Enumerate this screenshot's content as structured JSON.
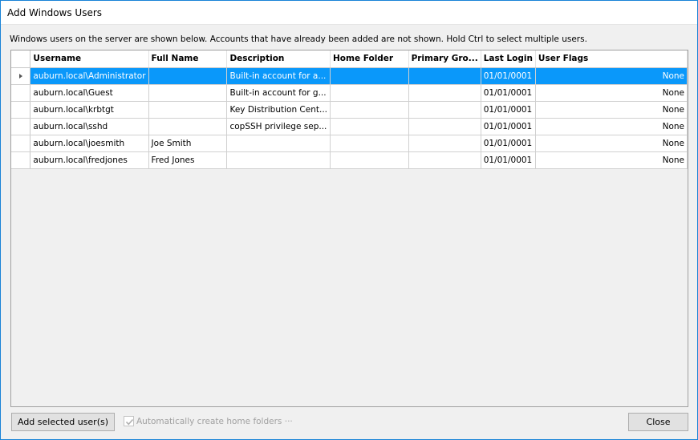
{
  "window": {
    "title": "Add Windows Users"
  },
  "instructions": "Windows users on the server are shown below.  Accounts that have already been added are not shown.  Hold Ctrl to select multiple users.",
  "grid": {
    "columns": [
      "Username",
      "Full Name",
      "Description",
      "Home Folder",
      "Primary Gro...",
      "Last Login",
      "User Flags"
    ],
    "rows": [
      {
        "username": "auburn.local\\Administrator",
        "full_name": "",
        "description": "Built-in account for a...",
        "home_folder": "",
        "primary_group": "",
        "last_login": "01/01/0001",
        "user_flags": "None",
        "selected": true
      },
      {
        "username": "auburn.local\\Guest",
        "full_name": "",
        "description": "Built-in account for g...",
        "home_folder": "",
        "primary_group": "",
        "last_login": "01/01/0001",
        "user_flags": "None",
        "selected": false
      },
      {
        "username": "auburn.local\\krbtgt",
        "full_name": "",
        "description": "Key Distribution Cent...",
        "home_folder": "",
        "primary_group": "",
        "last_login": "01/01/0001",
        "user_flags": "None",
        "selected": false
      },
      {
        "username": "auburn.local\\sshd",
        "full_name": "",
        "description": "copSSH privilege sep...",
        "home_folder": "",
        "primary_group": "",
        "last_login": "01/01/0001",
        "user_flags": "None",
        "selected": false
      },
      {
        "username": "auburn.local\\joesmith",
        "full_name": "Joe Smith",
        "description": "",
        "home_folder": "",
        "primary_group": "",
        "last_login": "01/01/0001",
        "user_flags": "None",
        "selected": false
      },
      {
        "username": "auburn.local\\fredjones",
        "full_name": "Fred Jones",
        "description": "",
        "home_folder": "",
        "primary_group": "",
        "last_login": "01/01/0001",
        "user_flags": "None",
        "selected": false
      }
    ],
    "selection_color": "#0a98fa"
  },
  "footer": {
    "add_label": "Add selected user(s)",
    "auto_create_label": "Automatically create home folders ···",
    "auto_create_checked": true,
    "auto_create_enabled": false,
    "close_label": "Close"
  }
}
